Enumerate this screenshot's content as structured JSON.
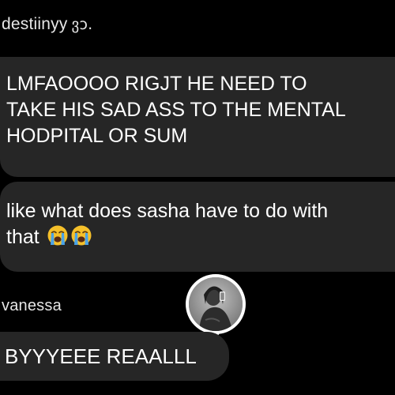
{
  "conversation": {
    "sender_top": {
      "name": "destiinyy",
      "suffix": "ვɔ."
    },
    "message_1": {
      "lines": [
        "LMFAOOOO RIGJT HE NEED TO",
        "TAKE HIS SAD ASS TO THE MENTAL",
        "HODPITAL OR SUM"
      ]
    },
    "message_2": {
      "lines": [
        "like what does sasha have to do with",
        "that"
      ],
      "emojis": [
        "loudly-crying-face-icon",
        "loudly-crying-face-icon"
      ]
    },
    "sender_bottom": {
      "name": "vanessa"
    },
    "message_3": {
      "text": "BYYYEEE REAALLL"
    }
  },
  "colors": {
    "background": "#000000",
    "bubble": "#262626",
    "text": "#ffffff",
    "sender_text": "#e6e6e6",
    "emoji_face": "#f5c02a",
    "emoji_tears": "#4aa3e8"
  }
}
